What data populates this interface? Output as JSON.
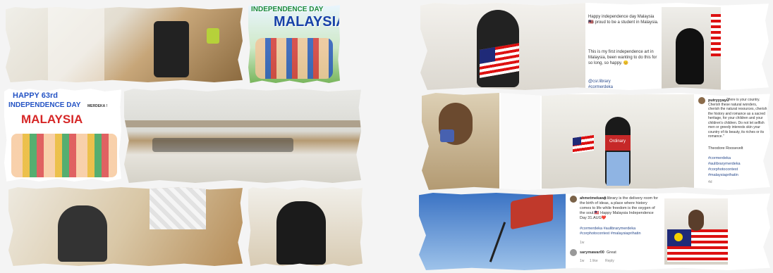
{
  "left": {
    "poster1": {
      "title": "INDEPENDENCE DAY",
      "country": "MALAYSIA"
    },
    "poster2": {
      "line1": "HAPPY 63rd",
      "line2": "INDEPENDENCE DAY",
      "country": "MALAYSIA",
      "badge": "MERDEKA !"
    }
  },
  "top_post": {
    "lines": [
      "Happy independence day Malaysia🇲🇾",
      "I'm proud to be a student in Malaysia.",
      "This is my first independence art in",
      "Malaysia, been wanting to do this for",
      "so long, so happy. 😊"
    ],
    "tags": [
      "@csr.library",
      "#cormerdeka"
    ]
  },
  "middle_post": {
    "username": "putryyyayu",
    "text": "\"Here is your country. Cherish these natural wonders, cherish the natural resources, cherish the history and romance as a sacred heritage, for your children and your children's children. Do not let selfish men or greedy interests skin your country of its beauty, its riches or its romance.\"",
    "author": "Theodore Roosevelt",
    "tags": [
      "#cormerdeka",
      "#aulibrarymerdeka",
      "#corphotocontest",
      "#malaysiaprihatin"
    ],
    "age": "4d",
    "shirt": "Ordinary"
  },
  "bottom_post": {
    "username": "ahmetmekawy",
    "text": "A library is the delivery room for the birth of ideas, a place where history comes to life while freedom is the oxygen of the soul.🇲🇾 Happy Malaysia Independence Day 31.AUG❤️",
    "tags": "#cormerdeka #aulibrarymerdeka #corphotocontest #malaysiaprihatin",
    "age": "1w",
    "comment_user": "sarymawar00",
    "comment": "Great",
    "comment_meta": [
      "1w",
      "1 like",
      "Reply"
    ]
  }
}
